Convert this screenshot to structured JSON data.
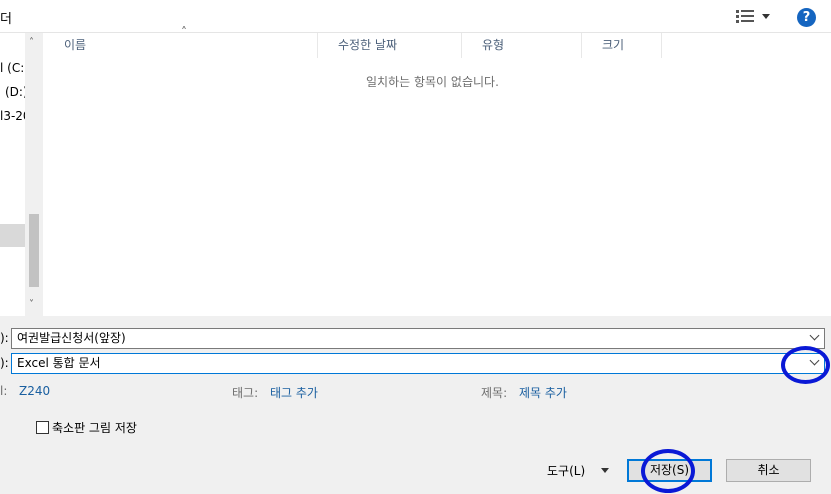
{
  "toolbar": {
    "title_fragment": "더",
    "help_label": "?"
  },
  "nav": {
    "items": [
      "l (C:)",
      "(D:)",
      "l3-20"
    ],
    "scroll_up": "˄",
    "scroll_down": "˅"
  },
  "filelist": {
    "columns": [
      "이름",
      "수정한 날짜",
      "유형",
      "크기"
    ],
    "sort_indicator": "˄",
    "empty_message": "일치하는 항목이 없습니다."
  },
  "form": {
    "filename_label": "):",
    "filename_value": "여권발급신청서(앞장)",
    "filetype_label": "):",
    "filetype_value": "Excel 통합 문서",
    "author_label": "l:",
    "author_value": "Z240",
    "tags_label": "태그:",
    "tags_value": "태그 추가",
    "title_label": "제목:",
    "title_value": "제목 추가",
    "thumbnail_label": "축소판 그림 저장"
  },
  "buttons": {
    "tools_label": "도구(L)",
    "save_label": "저장(S)",
    "cancel_label": "취소"
  },
  "colors": {
    "accent": "#0078d7",
    "annotation_circle": "#0a19d6",
    "link": "#1a5fa0"
  },
  "icons": [
    "view-options-icon",
    "help-icon",
    "chevron-down-icon",
    "sort-arrow-icon",
    "checkbox-icon"
  ]
}
